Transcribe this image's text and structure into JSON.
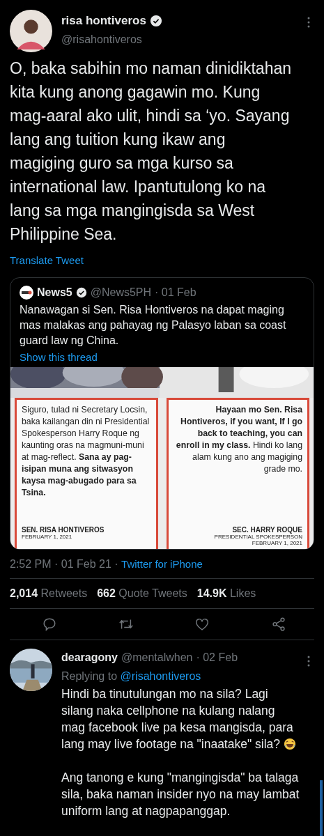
{
  "tweet": {
    "name": "risa hontiveros",
    "handle": "@risahontiveros",
    "text": "O, baka sabihin mo naman dinidiktahan kita kung anong gagawin mo. Kung mag-aaral ako ulit, hindi sa ‘yo. Sayang lang ang tuition kung ikaw ang magiging guro sa mga kurso sa international law. Ipantutulong ko na lang sa mga mangingisda sa West Philippine Sea.",
    "translate": "Translate Tweet",
    "quote": {
      "name": "News5",
      "handle": "@News5PH",
      "date": "· 01 Feb",
      "text": "Nanawagan si Sen. Risa Hontiveros na dapat maging mas malakas ang pahayag ng Palasyo laban sa coast guard law ng China.",
      "show_thread": "Show this thread",
      "cards": [
        {
          "kind": "left",
          "text": "Siguro, tulad ni Secretary Locsin, baka kailangan din ni Presidential Spokesperson Harry Roque ng kaunting oras na magmuni-muni at mag-reflect. **Sana ay pag-isipan muna ang sitwasyon kaysa mag-abugado para sa Tsina.**",
          "speaker": "SEN. RISA HONTIVEROS",
          "lines": [
            "FEBRUARY 1, 2021"
          ]
        },
        {
          "kind": "right",
          "text": "**Hayaan mo Sen. Risa Hontiveros, if you want, If I go back to teaching, you can enroll in my class.** Hindi ko lang alam kung ano ang magiging grade mo.",
          "speaker": "SEC. HARRY ROQUE",
          "lines": [
            "PRESIDENTIAL SPOKESPERSON",
            "FEBRUARY 1, 2021"
          ]
        }
      ]
    },
    "time": "2:52 PM · 01 Feb 21 ·",
    "source": "Twitter for iPhone",
    "stats": [
      {
        "count": "2,014",
        "label": "Retweets"
      },
      {
        "count": "662",
        "label": "Quote Tweets"
      },
      {
        "count": "14.9K",
        "label": "Likes"
      }
    ],
    "actions": [
      {
        "kind": "reply"
      },
      {
        "kind": "retweet"
      },
      {
        "kind": "like"
      },
      {
        "kind": "share"
      }
    ]
  },
  "reply": {
    "name": "dearagony",
    "handle": "@mentalwhen",
    "date": "· 02 Feb",
    "replying_to": "Replying to",
    "replying_handle": "@risahontiveros",
    "paragraphs": [
      "Hindi ba tinutulungan mo na sila? Lagi silang naka cellphone na kulang nalang mag facebook live pa kesa mangisda, para lang may live footage na \"inaatake\" sila?",
      "Ang tanong e kung \"mangingisda\" ba talaga sila, baka naman insider nyo na may lambat uniform lang at nagpapanggap."
    ]
  }
}
